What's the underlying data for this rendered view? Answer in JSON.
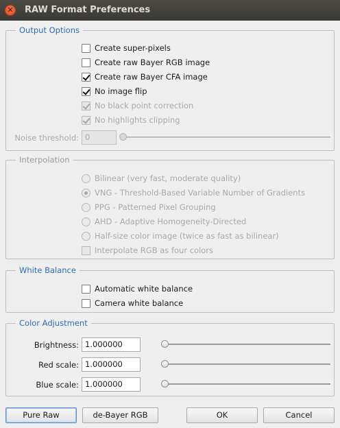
{
  "window": {
    "title": "RAW Format Preferences"
  },
  "output_options": {
    "legend": "Output Options",
    "items": [
      {
        "label": "Create super-pixels",
        "checked": false,
        "enabled": true
      },
      {
        "label": "Create raw Bayer RGB image",
        "checked": false,
        "enabled": true
      },
      {
        "label": "Create raw Bayer CFA image",
        "checked": true,
        "enabled": true
      },
      {
        "label": "No image flip",
        "checked": true,
        "enabled": true
      },
      {
        "label": "No black point correction",
        "checked": true,
        "enabled": false
      },
      {
        "label": "No highlights clipping",
        "checked": true,
        "enabled": false
      }
    ],
    "noise_threshold": {
      "label": "Noise threshold:",
      "value": "0",
      "slider_fraction": 0
    }
  },
  "interpolation": {
    "legend": "Interpolation",
    "options": [
      {
        "label": "Bilinear (very fast, moderate quality)",
        "selected": false
      },
      {
        "label": "VNG - Threshold-Based Variable Number of Gradients",
        "selected": true
      },
      {
        "label": "PPG - Patterned Pixel Grouping",
        "selected": false
      },
      {
        "label": "AHD - Adaptive Homogeneity-Directed",
        "selected": false
      },
      {
        "label": "Half-size color image (twice as fast as bilinear)",
        "selected": false
      }
    ],
    "four_colors": {
      "label": "Interpolate RGB as four colors",
      "checked": false
    }
  },
  "white_balance": {
    "legend": "White Balance",
    "items": [
      {
        "label": "Automatic white balance",
        "checked": false
      },
      {
        "label": "Camera white balance",
        "checked": false
      }
    ]
  },
  "color_adjustment": {
    "legend": "Color Adjustment",
    "brightness": {
      "label": "Brightness:",
      "value": "1.000000"
    },
    "red_scale": {
      "label": "Red scale:",
      "value": "1.000000"
    },
    "blue_scale": {
      "label": "Blue scale:",
      "value": "1.000000"
    }
  },
  "buttons": {
    "pure_raw": "Pure Raw",
    "debayer": "de-Bayer RGB",
    "ok": "OK",
    "cancel": "Cancel"
  }
}
